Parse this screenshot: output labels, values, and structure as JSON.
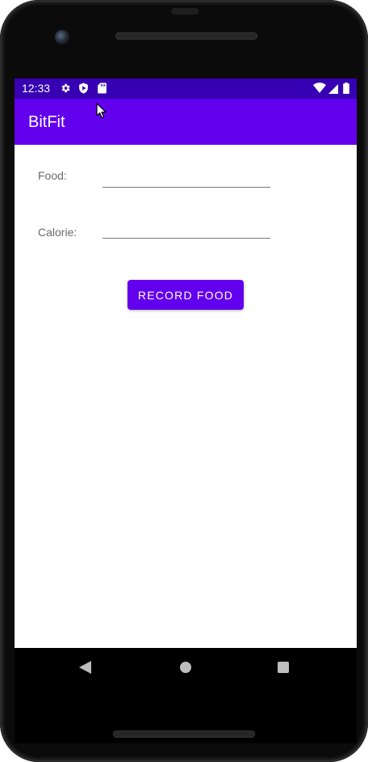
{
  "status_bar": {
    "time": "12:33",
    "left_icons": [
      "gear-icon",
      "play-protect-icon",
      "sd-card-icon"
    ],
    "right_icons": [
      "wifi-icon",
      "cellular-signal-icon",
      "battery-icon"
    ]
  },
  "app_bar": {
    "title": "BitFit"
  },
  "form": {
    "food_label": "Food:",
    "food_value": "",
    "calorie_label": "Calorie:",
    "calorie_value": ""
  },
  "record_button_label": "RECORD FOOD",
  "navigation": [
    "back-icon",
    "home-icon",
    "recents-icon"
  ],
  "colors": {
    "primary": "#6200ee",
    "primary_dark": "#3700b3",
    "label": "#6b6b6b",
    "nav_bar": "#000000"
  }
}
